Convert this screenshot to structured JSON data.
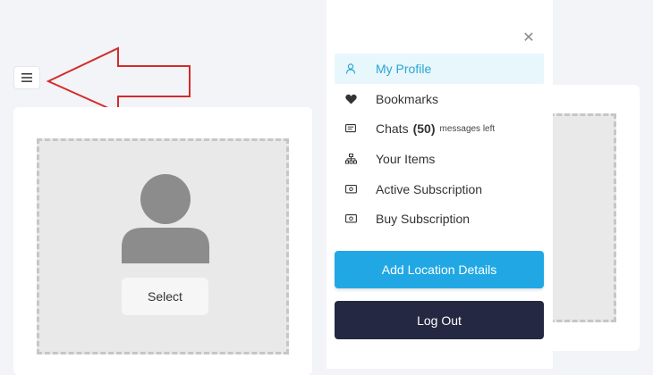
{
  "header": {
    "menu_icon": "hamburger-icon"
  },
  "photo_upload": {
    "select_label": "Select",
    "placeholder_icon": "user-silhouette-icon"
  },
  "menu": {
    "close_icon": "close-icon",
    "items": [
      {
        "label": "My Profile",
        "icon": "user-icon",
        "active": true
      },
      {
        "label": "Bookmarks",
        "icon": "heart-icon"
      },
      {
        "label": "Chats",
        "count": "(50)",
        "suffix": "messages left",
        "icon": "chat-icon"
      },
      {
        "label": "Your Items",
        "icon": "sitemap-icon"
      },
      {
        "label": "Active Subscription",
        "icon": "money-icon"
      },
      {
        "label": "Buy Subscription",
        "icon": "money-icon"
      }
    ],
    "add_location_label": "Add Location Details",
    "logout_label": "Log Out"
  },
  "colors": {
    "accent": "#29a6d6",
    "active_bg": "#e8f7fb",
    "primary_button": "#21a8e4",
    "dark_button": "#242842",
    "annotation": "#d42b2b"
  }
}
